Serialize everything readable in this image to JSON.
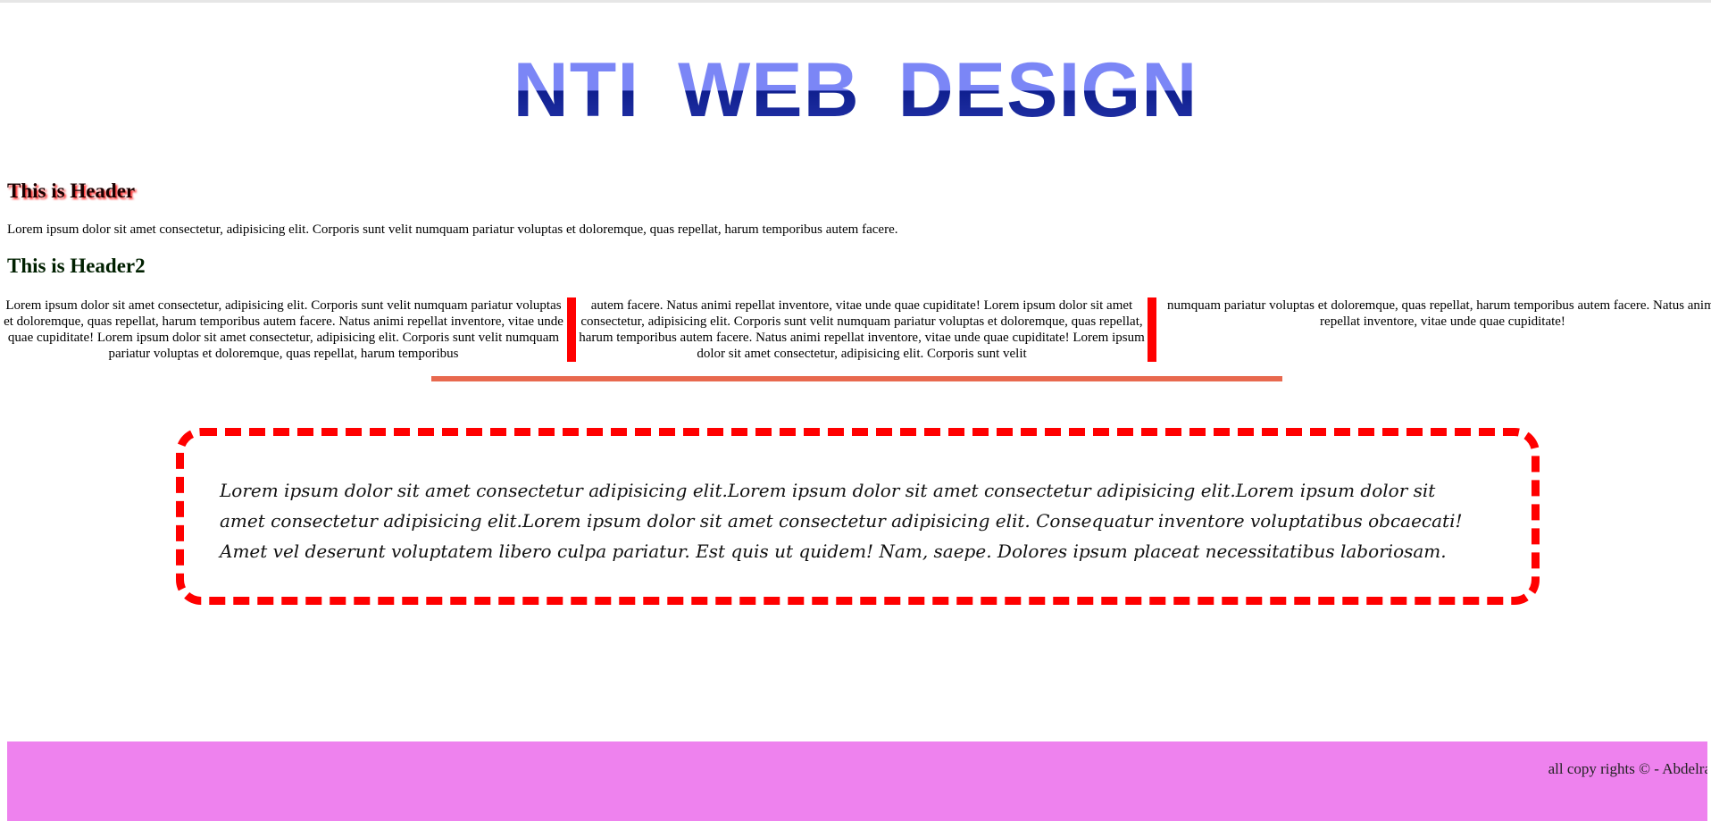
{
  "logo": {
    "text": "NTI WEB DESIGN"
  },
  "section1": {
    "header": "This is Header",
    "paragraph": "Lorem ipsum dolor sit amet consectetur, adipisicing elit. Corporis sunt velit numquam pariatur voluptas et doloremque, quas repellat, harum temporibus autem facere."
  },
  "section2": {
    "header": "This is Header2",
    "columns": [
      "Lorem ipsum dolor sit amet consectetur, adipisicing elit. Corporis sunt velit numquam pariatur voluptas et doloremque, quas repellat, harum temporibus autem facere. Natus animi repellat inventore, vitae unde quae cupiditate! Lorem ipsum dolor sit amet consectetur, adipisicing elit. Corporis sunt velit numquam pariatur voluptas et doloremque, quas repellat, harum temporibus",
      "autem facere. Natus animi repellat inventore, vitae unde quae cupiditate! Lorem ipsum dolor sit amet consectetur, adipisicing elit. Corporis sunt velit numquam pariatur voluptas et doloremque, quas repellat, harum temporibus autem facere. Natus animi repellat inventore, vitae unde quae cupiditate! Lorem ipsum dolor sit amet consectetur, adipisicing elit. Corporis sunt velit",
      "numquam pariatur voluptas et doloremque, quas repellat, harum temporibus autem facere. Natus animi repellat inventore, vitae unde quae cupiditate!"
    ]
  },
  "quote": {
    "text": "Lorem ipsum dolor sit amet consectetur adipisicing elit.Lorem ipsum dolor sit amet consectetur adipisicing elit.Lorem ipsum dolor sit amet consectetur adipisicing elit.Lorem ipsum dolor sit amet consectetur adipisicing elit. Consequatur inventore voluptatibus obcaecati! Amet vel deserunt voluptatem libero culpa pariatur. Est quis ut quidem! Nam, saepe. Dolores ipsum placeat necessitatibus laboriosam."
  },
  "footer": {
    "text": "all copy rights © - Abdelra"
  },
  "colors": {
    "logo_light": "#7b86f6",
    "logo_dark": "#0f1f8f",
    "header_shadow": "#ff2a2a",
    "column_rule": "#ff0000",
    "divider": "#e8694f",
    "quote_border": "#ff0000",
    "footer_background": "#ee82ee"
  }
}
